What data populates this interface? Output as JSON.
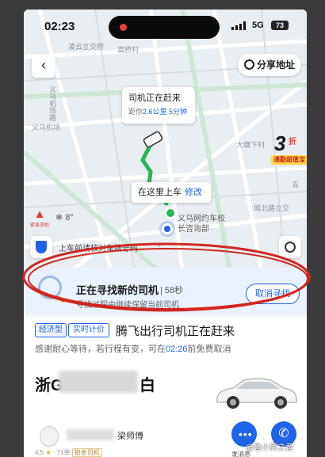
{
  "status_bar": {
    "time": "02:23",
    "network": "5G",
    "battery": "73"
  },
  "map": {
    "labels": {
      "top_left": "凌云立交桥",
      "top_mid": "高桥村",
      "airport_vertical": "义乌机场路",
      "airport": "义乌机场",
      "right_mid": "大塘下村",
      "bottom_right": "城北路立交",
      "right_road": "五"
    },
    "share_button": "分享地址",
    "driver_bubble": {
      "title": "司机正在赶来",
      "sub_prefix": "距你",
      "distance": "2.6公里",
      "time": "5分钟"
    },
    "promo": {
      "number": "3",
      "unit": "折",
      "banner": "通勤超值宝"
    },
    "pickup": {
      "label": "在这里上车",
      "edit": "修改"
    },
    "pickup_location": {
      "line1": "义乌网约车校",
      "line2": "长咨询部"
    },
    "emergency_label": "紧急求助",
    "weather": "8°",
    "safety_tip": "上车前请核对车牌号码",
    "safety_tip_tail": "·"
  },
  "search_card": {
    "title": "正在寻找新的司机",
    "seconds": "| 58秒",
    "subtitle": "寻找过程中继续保留当前司机",
    "cancel": "取消寻找"
  },
  "trip": {
    "tag_type": "经济型",
    "tag_meter": "实时计价",
    "headline": "腾飞出行司机正在赶来",
    "notice_prefix": "感谢耐心等待，若行程有变，可在",
    "notice_time": "02:26",
    "notice_suffix": "前免费取消",
    "plate_prefix": "浙G",
    "plate_suffix": "白",
    "driver_name": "梁师傅",
    "rating": "4.5",
    "orders": "71单",
    "badge": "铂金司机",
    "message_label": "发消息"
  },
  "watermark": "@鲁小厉之音"
}
